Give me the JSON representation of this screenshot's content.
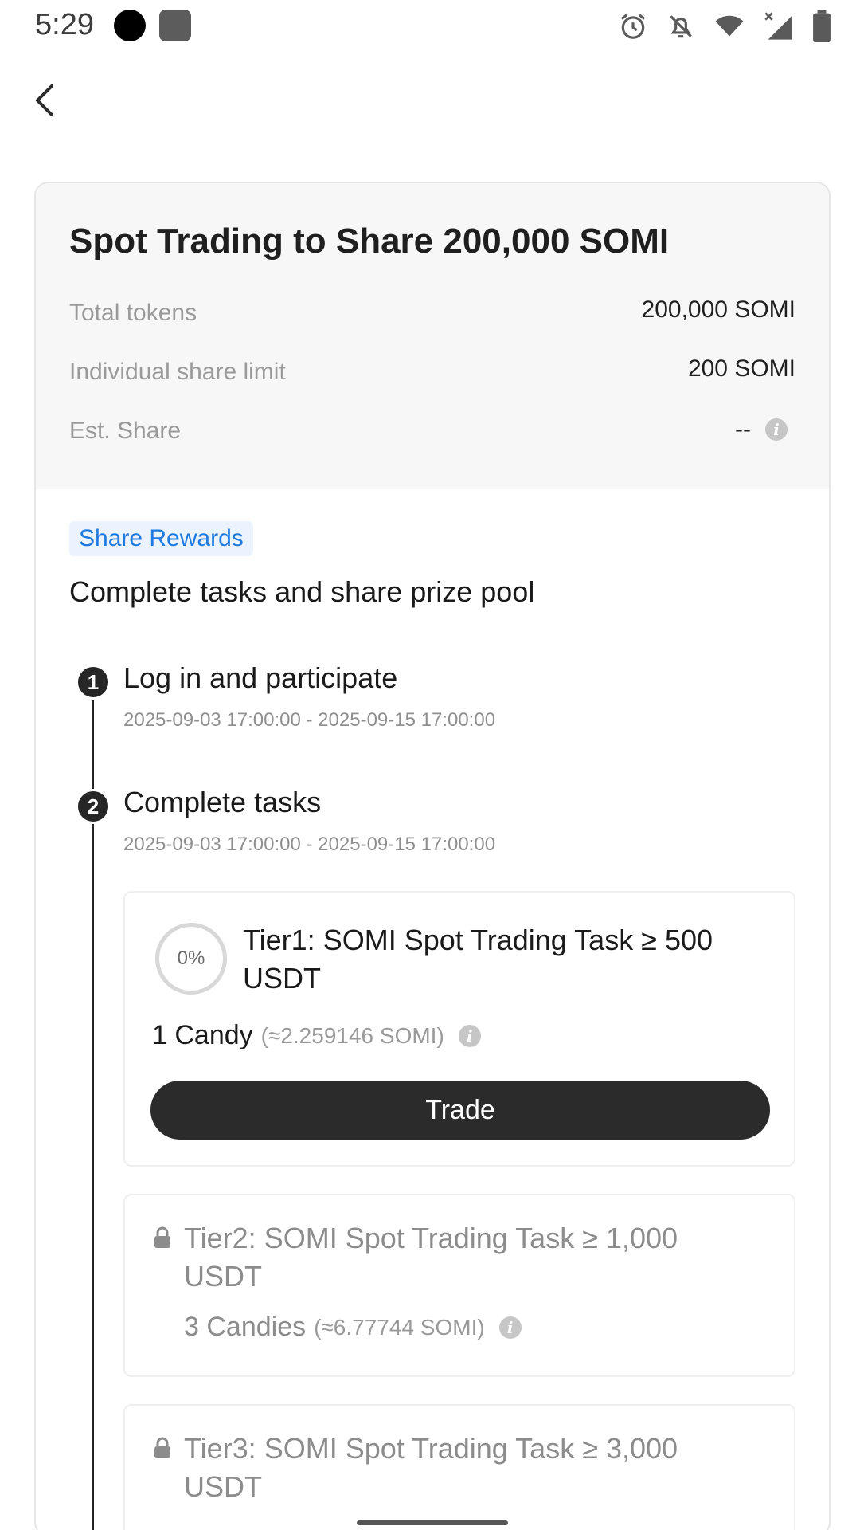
{
  "status_bar": {
    "time": "5:29",
    "icons": [
      "alarm-icon",
      "notifications-off-icon",
      "wifi-icon",
      "signal-icon",
      "battery-icon"
    ]
  },
  "header": {
    "back_icon": "chevron-left-icon"
  },
  "campaign": {
    "title": "Spot Trading to Share 200,000 SOMI",
    "info_rows": [
      {
        "label": "Total tokens",
        "value": "200,000 SOMI"
      },
      {
        "label": "Individual share limit",
        "value": "200 SOMI"
      },
      {
        "label": "Est. Share",
        "value": "--"
      }
    ]
  },
  "rewards": {
    "badge": "Share Rewards",
    "subtitle": "Complete tasks and share prize pool"
  },
  "steps": [
    {
      "number": "1",
      "title": "Log in and participate",
      "time": "2025-09-03 17:00:00 - 2025-09-15 17:00:00"
    },
    {
      "number": "2",
      "title": "Complete tasks",
      "time": "2025-09-03 17:00:00 - 2025-09-15 17:00:00"
    }
  ],
  "tasks": [
    {
      "progress": "0%",
      "title": "Tier1: SOMI Spot Trading Task ≥ 500 USDT",
      "reward": "1 Candy",
      "approx": "(≈2.259146 SOMI)",
      "button": "Trade",
      "locked": false
    },
    {
      "title": "Tier2: SOMI Spot Trading Task ≥ 1,000 USDT",
      "reward": "3 Candies",
      "approx": "(≈6.77744 SOMI)",
      "locked": true
    },
    {
      "title": "Tier3: SOMI Spot Trading Task ≥ 3,000 USDT",
      "locked": true
    }
  ],
  "colors": {
    "accent": "#1f7ae0",
    "badge_bg": "#eaf3fe",
    "button_bg": "#2b2b2b",
    "header_bg": "#f7f7f7"
  }
}
